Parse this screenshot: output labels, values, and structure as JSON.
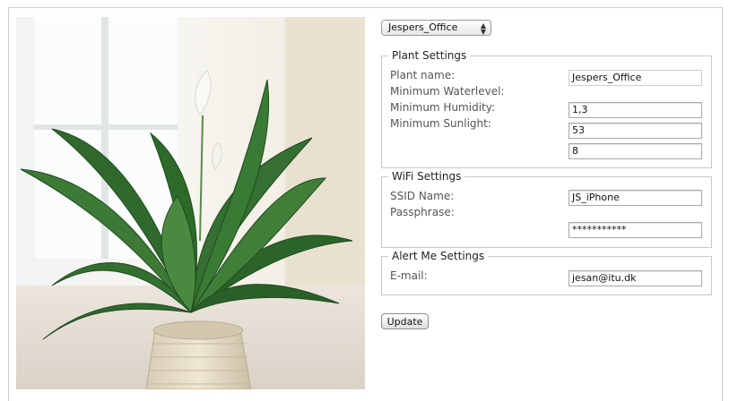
{
  "plant_select": {
    "value": "Jespers_Office"
  },
  "plant_settings": {
    "legend": "Plant Settings",
    "labels": {
      "plant_name": "Plant name:",
      "min_water": "Minimum Waterlevel:",
      "min_humidity": "Minimum Humidity:",
      "min_sunlight": "Minimum Sunlight:"
    },
    "values": {
      "plant_name": "Jespers_Office",
      "min_water": "1,3",
      "min_humidity": "53",
      "min_sunlight": "8"
    }
  },
  "wifi_settings": {
    "legend": "WiFi Settings",
    "labels": {
      "ssid": "SSID Name:",
      "passphrase": "Passphrase:"
    },
    "values": {
      "ssid": "JS_iPhone",
      "passphrase": "***********"
    }
  },
  "alert_settings": {
    "legend": "Alert Me Settings",
    "labels": {
      "email": "E-mail:"
    },
    "values": {
      "email": "jesan@itu.dk"
    }
  },
  "actions": {
    "update_label": "Update"
  },
  "icons": {
    "select_arrows": "up-down-arrows-icon"
  }
}
